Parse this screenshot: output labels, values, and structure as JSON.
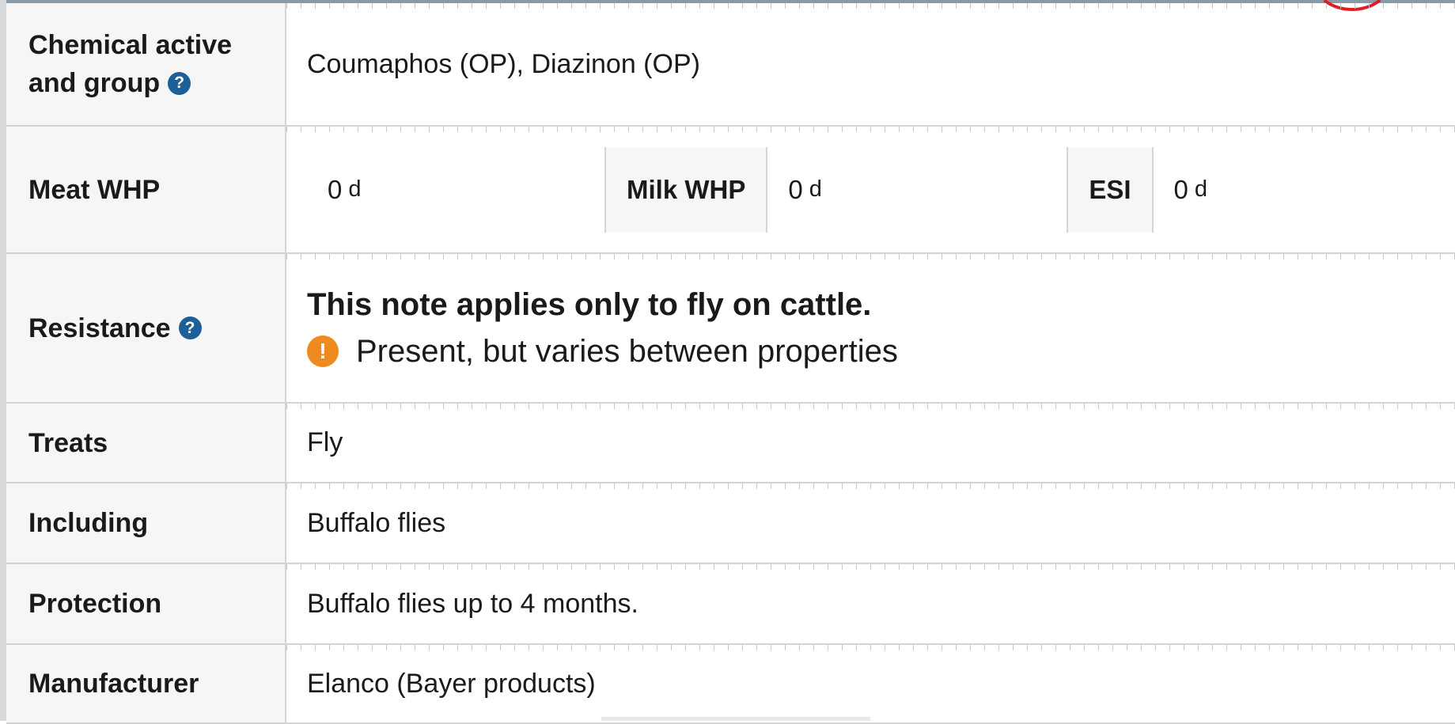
{
  "rows": {
    "chemical": {
      "label_line1": "Chemical active",
      "label_line2": "and group",
      "value": "Coumaphos (OP), Diazinon (OP)"
    },
    "whp": {
      "meat_label": "Meat WHP",
      "meat_value": "0",
      "meat_unit": "d",
      "milk_label": "Milk WHP",
      "milk_value": "0",
      "milk_unit": "d",
      "esi_label": "ESI",
      "esi_value": "0",
      "esi_unit": "d"
    },
    "resistance": {
      "label": "Resistance",
      "note": "This note applies only to fly on cattle.",
      "status": "Present, but varies between properties"
    },
    "treats": {
      "label": "Treats",
      "value": "Fly"
    },
    "including": {
      "label": "Including",
      "value": "Buffalo flies"
    },
    "protection": {
      "label": "Protection",
      "value": "Buffalo flies up to 4 months."
    },
    "manufacturer": {
      "label": "Manufacturer",
      "value": "Elanco (Bayer products)"
    }
  },
  "icons": {
    "help_glyph": "?",
    "warning_glyph": "!"
  },
  "colors": {
    "help_icon": "#1d5f97",
    "warning_icon": "#ef8a1f",
    "label_bg": "#f6f6f6",
    "border": "#d4d4d4"
  }
}
